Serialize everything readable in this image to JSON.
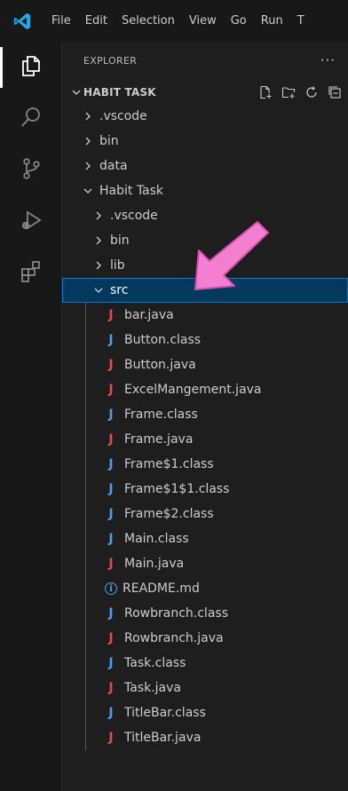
{
  "menu": [
    "File",
    "Edit",
    "Selection",
    "View",
    "Go",
    "Run",
    "T"
  ],
  "activity_bar": {
    "items": [
      {
        "icon": "files-icon",
        "active": true
      },
      {
        "icon": "search-icon",
        "active": false
      },
      {
        "icon": "source-control-icon",
        "active": false
      },
      {
        "icon": "run-debug-icon",
        "active": false
      },
      {
        "icon": "extensions-icon",
        "active": false
      }
    ]
  },
  "explorer": {
    "title": "EXPLORER",
    "more": "···",
    "section_title": "HABIT TASK",
    "section_actions": [
      "new-file-icon",
      "new-folder-icon",
      "refresh-icon",
      "collapse-all-icon"
    ],
    "tree": [
      {
        "label": ".vscode",
        "kind": "folder",
        "depth": 0,
        "expanded": false
      },
      {
        "label": "bin",
        "kind": "folder",
        "depth": 0,
        "expanded": false
      },
      {
        "label": "data",
        "kind": "folder",
        "depth": 0,
        "expanded": false
      },
      {
        "label": "Habit Task",
        "kind": "folder",
        "depth": 0,
        "expanded": true
      },
      {
        "label": ".vscode",
        "kind": "folder",
        "depth": 1,
        "expanded": false
      },
      {
        "label": "bin",
        "kind": "folder",
        "depth": 1,
        "expanded": false
      },
      {
        "label": "lib",
        "kind": "folder",
        "depth": 1,
        "expanded": false
      },
      {
        "label": "src",
        "kind": "folder",
        "depth": 1,
        "expanded": true,
        "selected": true
      },
      {
        "label": "bar.java",
        "kind": "java",
        "depth": 2
      },
      {
        "label": "Button.class",
        "kind": "class",
        "depth": 2
      },
      {
        "label": "Button.java",
        "kind": "java",
        "depth": 2
      },
      {
        "label": "ExcelMangement.java",
        "kind": "java",
        "depth": 2
      },
      {
        "label": "Frame.class",
        "kind": "class",
        "depth": 2
      },
      {
        "label": "Frame.java",
        "kind": "java",
        "depth": 2
      },
      {
        "label": "Frame$1.class",
        "kind": "class",
        "depth": 2
      },
      {
        "label": "Frame$1$1.class",
        "kind": "class",
        "depth": 2
      },
      {
        "label": "Frame$2.class",
        "kind": "class",
        "depth": 2
      },
      {
        "label": "Main.class",
        "kind": "class",
        "depth": 2
      },
      {
        "label": "Main.java",
        "kind": "java",
        "depth": 2
      },
      {
        "label": "README.md",
        "kind": "info",
        "depth": 2
      },
      {
        "label": "Rowbranch.class",
        "kind": "class",
        "depth": 2
      },
      {
        "label": "Rowbranch.java",
        "kind": "java",
        "depth": 2
      },
      {
        "label": "Task.class",
        "kind": "class",
        "depth": 2
      },
      {
        "label": "Task.java",
        "kind": "java",
        "depth": 2
      },
      {
        "label": "TitleBar.class",
        "kind": "class",
        "depth": 2
      },
      {
        "label": "TitleBar.java",
        "kind": "java",
        "depth": 2
      }
    ]
  },
  "annotation": {
    "icon": "pink-arrow-icon",
    "color": "#f47fd0"
  },
  "colors": {
    "class_icon": "#4e9fe8",
    "java_icon": "#e84a4a",
    "selection_bg": "#04395e",
    "selection_border": "#0078d4",
    "brand": "#23a9f2"
  }
}
